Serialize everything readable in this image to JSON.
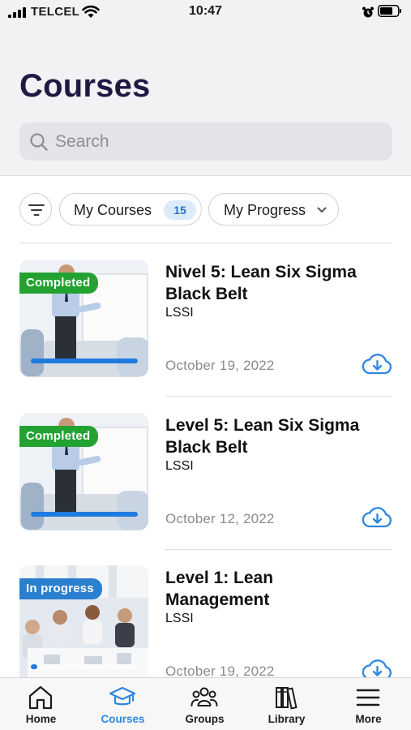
{
  "status_bar": {
    "carrier": "TELCEL",
    "time": "10:47"
  },
  "header": {
    "title": "Courses"
  },
  "search": {
    "placeholder": "Search",
    "value": ""
  },
  "filters": {
    "my_courses_label": "My Courses",
    "my_courses_count": "15",
    "my_progress_label": "My Progress"
  },
  "courses": [
    {
      "title": "Nivel 5: Lean Six Sigma Black Belt",
      "provider": "LSSI",
      "date": "October 19, 2022",
      "status": "Completed",
      "progress": 1.0
    },
    {
      "title": "Level 5: Lean Six Sigma Black Belt",
      "provider": "LSSI",
      "date": "October 12, 2022",
      "status": "Completed",
      "progress": 1.0
    },
    {
      "title": "Level 1: Lean Management",
      "provider": "LSSI",
      "date": "October 19, 2022",
      "status": "In progress",
      "progress": 0.06
    }
  ],
  "tabbar": {
    "items": [
      {
        "label": "Home",
        "icon": "home-icon"
      },
      {
        "label": "Courses",
        "icon": "graduation-cap-icon",
        "active": true
      },
      {
        "label": "Groups",
        "icon": "groups-icon"
      },
      {
        "label": "Library",
        "icon": "library-icon"
      },
      {
        "label": "More",
        "icon": "menu-icon"
      }
    ]
  },
  "colors": {
    "title": "#1e1a44",
    "accent": "#2e86de",
    "completed_badge": "#23a232",
    "in_progress_badge": "#2b7fcf",
    "progress_bar": "#1f7be0"
  }
}
